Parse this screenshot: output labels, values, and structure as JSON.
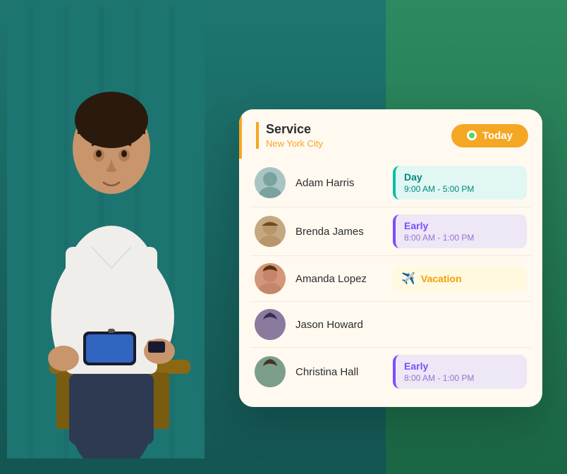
{
  "header": {
    "service_title": "Service",
    "service_subtitle": "New York City",
    "today_label": "Today"
  },
  "employees": [
    {
      "name": "Adam Harris",
      "avatar_color": "#a8c5c3",
      "avatar_emoji": "👤",
      "shift_type": "day",
      "shift_label": "Day",
      "shift_time": "9:00 AM - 5:00 PM"
    },
    {
      "name": "Brenda James",
      "avatar_color": "#c4a882",
      "avatar_emoji": "👤",
      "shift_type": "early",
      "shift_label": "Early",
      "shift_time": "8:00 AM - 1:00 PM"
    },
    {
      "name": "Amanda Lopez",
      "avatar_color": "#d4967a",
      "avatar_emoji": "👤",
      "shift_type": "vacation",
      "shift_label": "Vacation",
      "shift_time": ""
    },
    {
      "name": "Jason Howard",
      "avatar_color": "#8a7a9e",
      "avatar_emoji": "👤",
      "shift_type": "none",
      "shift_label": "",
      "shift_time": ""
    },
    {
      "name": "Christina Hall",
      "avatar_color": "#7a9e8a",
      "avatar_emoji": "👤",
      "shift_type": "early",
      "shift_label": "Early",
      "shift_time": "8:00 AM - 1:00 PM"
    }
  ]
}
